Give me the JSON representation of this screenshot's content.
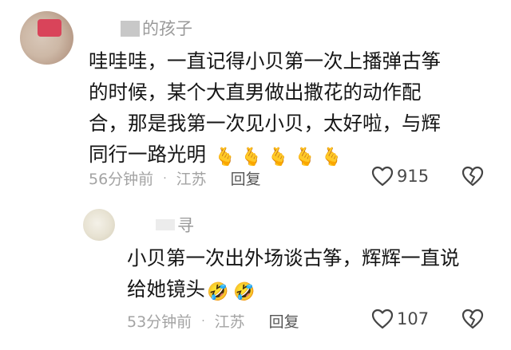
{
  "comments": [
    {
      "username": "的孩子",
      "text": "哇哇哇，一直记得小贝第一次上播弹古筝的时候，某个大直男做出撒花的动作配合，那是我第一次见小贝，太好啦，与辉同行一路光明",
      "lines": [
        "哇哇哇，一直记得小贝第一次上播弹古筝",
        "的时候，某个大直男做出撒花的动作配",
        "合，那是我第一次见小贝，太好啦，与辉",
        "同行一路光明"
      ],
      "emojis": [
        "🫰",
        "🫰",
        "🫰",
        "🫰",
        "🫰"
      ],
      "time": "56分钟前",
      "separator": "·",
      "location": "江苏",
      "reply_label": "回复",
      "likes": "915",
      "icons": {
        "like": "heart-outline-icon",
        "dislike": "broken-heart-icon"
      }
    },
    {
      "username": "寻",
      "text": "小贝第一次出外场谈古筝，辉辉一直说给她镜头",
      "lines": [
        "小贝第一次出外场谈古筝，辉辉一直说",
        "给她镜头"
      ],
      "emojis": [
        "🤣",
        "🤣"
      ],
      "time": "53分钟前",
      "separator": "·",
      "location": "江苏",
      "reply_label": "回复",
      "likes": "107",
      "icons": {
        "like": "heart-outline-icon",
        "dislike": "broken-heart-icon"
      }
    }
  ]
}
